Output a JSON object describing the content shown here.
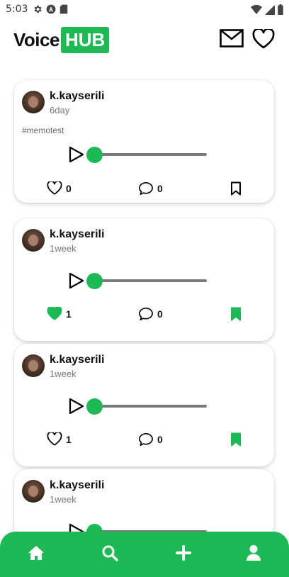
{
  "status_bar": {
    "time": "5:03",
    "left_icons": [
      "gear-icon",
      "app-icon",
      "sd-card-icon"
    ],
    "right_icons": [
      "wifi-icon",
      "signal-icon",
      "battery-icon"
    ]
  },
  "header": {
    "logo_part1": "Voice",
    "logo_part2": "HUB",
    "icons": [
      "mail-icon",
      "heart-icon"
    ]
  },
  "colors": {
    "accent": "#1db954",
    "track": "#7a7a7a",
    "text": "#111111",
    "muted": "#777777"
  },
  "posts": [
    {
      "username": "k.kayserili",
      "time_ago": "6day",
      "hashtag": "#memotest",
      "likes": "0",
      "liked": false,
      "comments": "0",
      "bookmarked": false,
      "progress": 0
    },
    {
      "username": "k.kayserili",
      "time_ago": "1week",
      "hashtag": "",
      "likes": "1",
      "liked": true,
      "comments": "0",
      "bookmarked": true,
      "progress": 0
    },
    {
      "username": "k.kayserili",
      "time_ago": "1week",
      "hashtag": "",
      "likes": "1",
      "liked": false,
      "comments": "0",
      "bookmarked": true,
      "progress": 0
    },
    {
      "username": "k.kayserili",
      "time_ago": "1week",
      "hashtag": "",
      "likes": "",
      "liked": false,
      "comments": "",
      "bookmarked": false,
      "progress": 0
    }
  ],
  "bottom_nav": {
    "items": [
      "home-icon",
      "search-icon",
      "add-icon",
      "profile-icon"
    ]
  }
}
